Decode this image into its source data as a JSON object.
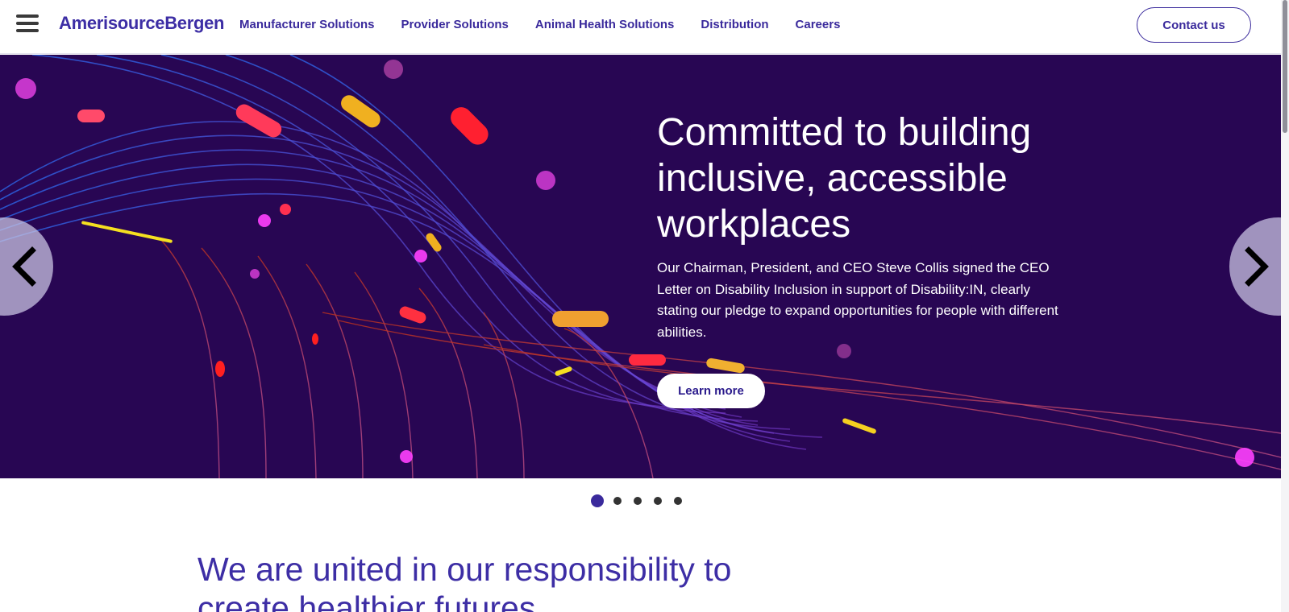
{
  "header": {
    "logo": "AmerisourceBergen",
    "nav": [
      "Manufacturer Solutions",
      "Provider Solutions",
      "Animal Health Solutions",
      "Distribution",
      "Careers"
    ],
    "contact_label": "Contact us"
  },
  "hero": {
    "title": "Committed to building inclusive, accessible workplaces",
    "body": "Our Chairman, President, and CEO Steve Collis signed the CEO Letter on Disability Inclusion in support of Disability:IN, clearly stating our pledge to expand opportunities for people with different abilities.",
    "cta_label": "Learn more",
    "slide_count": 5,
    "active_slide": 1
  },
  "mission": {
    "headline": "We are united in our responsibility to create healthier futures"
  },
  "icons": {
    "menu": "hamburger-icon",
    "prev": "chevron-left-icon",
    "next": "chevron-right-icon"
  },
  "colors": {
    "brand": "#3a2a9c",
    "hero_bg": "#280653",
    "dot_inactive": "#333333"
  }
}
